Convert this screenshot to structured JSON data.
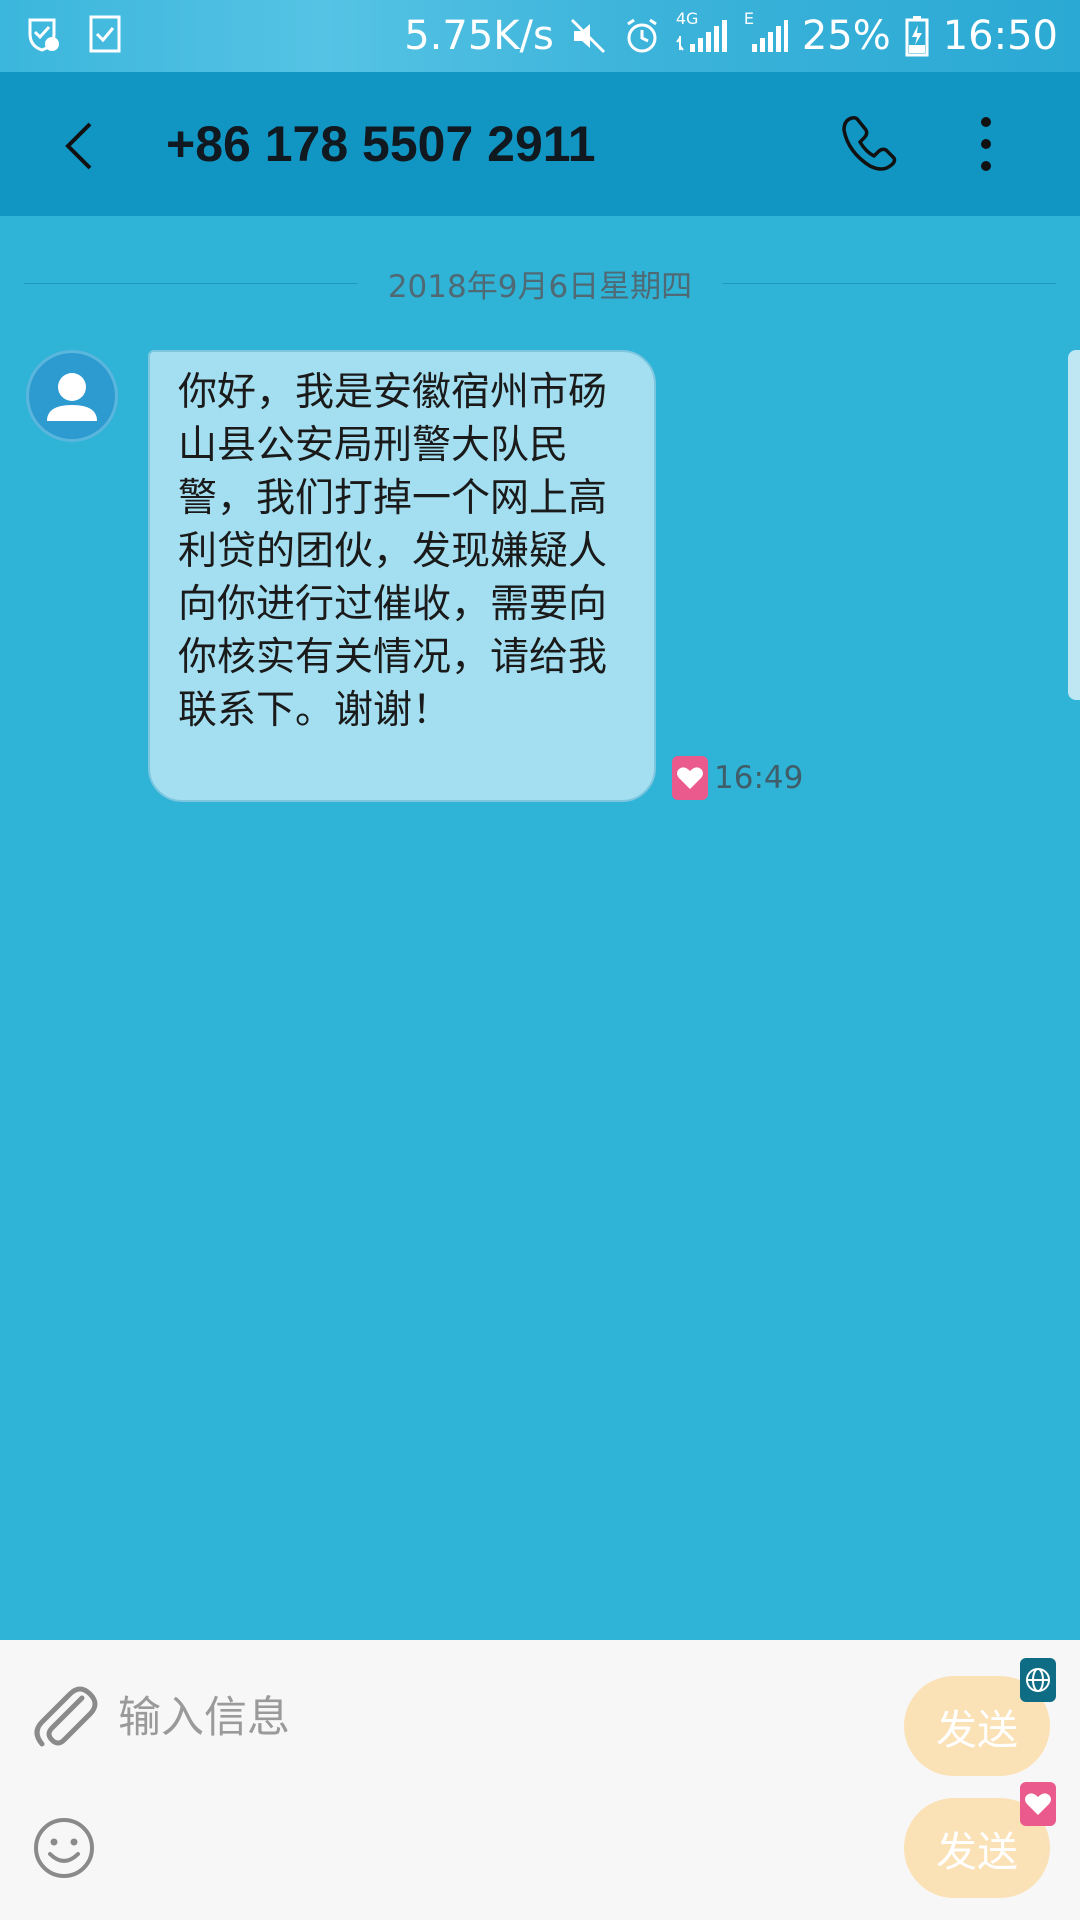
{
  "status_bar": {
    "network_speed": "5.75K/s",
    "network_type": "4G",
    "secondary_network": "E",
    "battery": "25%",
    "time": "16:50",
    "icons": [
      "shield-notification-icon",
      "task-check-icon",
      "mute-icon",
      "alarm-icon",
      "signal-icon",
      "signal-e-icon",
      "battery-charging-icon"
    ]
  },
  "app_bar": {
    "title": "+86 178 5507 2911",
    "icons": [
      "back-arrow-icon",
      "phone-icon",
      "more-vertical-icon"
    ]
  },
  "conversation": {
    "date": "2018年9月6日星期四",
    "messages": [
      {
        "text": "你好，我是安徽宿州市砀山县公安局刑警大队民警，我们打掉一个网上高利贷的团伙，发现嫌疑人向你进行过催收，需要向你核实有关情况，请给我联系下。谢谢！",
        "time": "16:49",
        "sim_icon": "heart-sim-icon",
        "avatar_icon": "person-avatar-icon"
      }
    ]
  },
  "composer": {
    "placeholder": "输入信息",
    "value": "",
    "send_label_sim1": "发送",
    "send_label_sim2": "发送",
    "icons": [
      "paperclip-icon",
      "emoji-icon",
      "globe-sim-icon",
      "heart-sim-icon"
    ]
  },
  "colors": {
    "background": "#2fb3d6",
    "app_bar": "#1196c4",
    "bubble": "#a3dff0",
    "send_button": "#fbe1b6",
    "heart_badge": "#ea5a8c",
    "globe_badge": "#0e6c84"
  }
}
